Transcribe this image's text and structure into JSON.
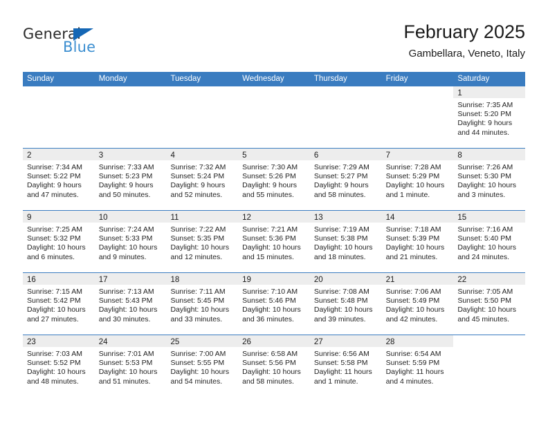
{
  "brand": {
    "name_part1": "General",
    "name_part2": "Blue",
    "triangle_color": "#1567b5",
    "blue_color": "#3b8ed0"
  },
  "header": {
    "title": "February 2025",
    "subtitle": "Gambellara, Veneto, Italy"
  },
  "theme": {
    "header_row_bg": "#3a7cc0",
    "row_divider": "#3a7cc0",
    "daynum_band_bg": "#ededed",
    "text": "#222222"
  },
  "calendar": {
    "weekday_headers": [
      "Sunday",
      "Monday",
      "Tuesday",
      "Wednesday",
      "Thursday",
      "Friday",
      "Saturday"
    ],
    "weeks": [
      [
        {
          "day": "",
          "empty": true,
          "lines": []
        },
        {
          "day": "",
          "empty": true,
          "lines": []
        },
        {
          "day": "",
          "empty": true,
          "lines": []
        },
        {
          "day": "",
          "empty": true,
          "lines": []
        },
        {
          "day": "",
          "empty": true,
          "lines": []
        },
        {
          "day": "",
          "empty": true,
          "lines": []
        },
        {
          "day": "1",
          "empty": false,
          "lines": [
            "Sunrise: 7:35 AM",
            "Sunset: 5:20 PM",
            "Daylight: 9 hours",
            "and 44 minutes."
          ]
        }
      ],
      [
        {
          "day": "2",
          "empty": false,
          "lines": [
            "Sunrise: 7:34 AM",
            "Sunset: 5:22 PM",
            "Daylight: 9 hours",
            "and 47 minutes."
          ]
        },
        {
          "day": "3",
          "empty": false,
          "lines": [
            "Sunrise: 7:33 AM",
            "Sunset: 5:23 PM",
            "Daylight: 9 hours",
            "and 50 minutes."
          ]
        },
        {
          "day": "4",
          "empty": false,
          "lines": [
            "Sunrise: 7:32 AM",
            "Sunset: 5:24 PM",
            "Daylight: 9 hours",
            "and 52 minutes."
          ]
        },
        {
          "day": "5",
          "empty": false,
          "lines": [
            "Sunrise: 7:30 AM",
            "Sunset: 5:26 PM",
            "Daylight: 9 hours",
            "and 55 minutes."
          ]
        },
        {
          "day": "6",
          "empty": false,
          "lines": [
            "Sunrise: 7:29 AM",
            "Sunset: 5:27 PM",
            "Daylight: 9 hours",
            "and 58 minutes."
          ]
        },
        {
          "day": "7",
          "empty": false,
          "lines": [
            "Sunrise: 7:28 AM",
            "Sunset: 5:29 PM",
            "Daylight: 10 hours",
            "and 1 minute."
          ]
        },
        {
          "day": "8",
          "empty": false,
          "lines": [
            "Sunrise: 7:26 AM",
            "Sunset: 5:30 PM",
            "Daylight: 10 hours",
            "and 3 minutes."
          ]
        }
      ],
      [
        {
          "day": "9",
          "empty": false,
          "lines": [
            "Sunrise: 7:25 AM",
            "Sunset: 5:32 PM",
            "Daylight: 10 hours",
            "and 6 minutes."
          ]
        },
        {
          "day": "10",
          "empty": false,
          "lines": [
            "Sunrise: 7:24 AM",
            "Sunset: 5:33 PM",
            "Daylight: 10 hours",
            "and 9 minutes."
          ]
        },
        {
          "day": "11",
          "empty": false,
          "lines": [
            "Sunrise: 7:22 AM",
            "Sunset: 5:35 PM",
            "Daylight: 10 hours",
            "and 12 minutes."
          ]
        },
        {
          "day": "12",
          "empty": false,
          "lines": [
            "Sunrise: 7:21 AM",
            "Sunset: 5:36 PM",
            "Daylight: 10 hours",
            "and 15 minutes."
          ]
        },
        {
          "day": "13",
          "empty": false,
          "lines": [
            "Sunrise: 7:19 AM",
            "Sunset: 5:38 PM",
            "Daylight: 10 hours",
            "and 18 minutes."
          ]
        },
        {
          "day": "14",
          "empty": false,
          "lines": [
            "Sunrise: 7:18 AM",
            "Sunset: 5:39 PM",
            "Daylight: 10 hours",
            "and 21 minutes."
          ]
        },
        {
          "day": "15",
          "empty": false,
          "lines": [
            "Sunrise: 7:16 AM",
            "Sunset: 5:40 PM",
            "Daylight: 10 hours",
            "and 24 minutes."
          ]
        }
      ],
      [
        {
          "day": "16",
          "empty": false,
          "lines": [
            "Sunrise: 7:15 AM",
            "Sunset: 5:42 PM",
            "Daylight: 10 hours",
            "and 27 minutes."
          ]
        },
        {
          "day": "17",
          "empty": false,
          "lines": [
            "Sunrise: 7:13 AM",
            "Sunset: 5:43 PM",
            "Daylight: 10 hours",
            "and 30 minutes."
          ]
        },
        {
          "day": "18",
          "empty": false,
          "lines": [
            "Sunrise: 7:11 AM",
            "Sunset: 5:45 PM",
            "Daylight: 10 hours",
            "and 33 minutes."
          ]
        },
        {
          "day": "19",
          "empty": false,
          "lines": [
            "Sunrise: 7:10 AM",
            "Sunset: 5:46 PM",
            "Daylight: 10 hours",
            "and 36 minutes."
          ]
        },
        {
          "day": "20",
          "empty": false,
          "lines": [
            "Sunrise: 7:08 AM",
            "Sunset: 5:48 PM",
            "Daylight: 10 hours",
            "and 39 minutes."
          ]
        },
        {
          "day": "21",
          "empty": false,
          "lines": [
            "Sunrise: 7:06 AM",
            "Sunset: 5:49 PM",
            "Daylight: 10 hours",
            "and 42 minutes."
          ]
        },
        {
          "day": "22",
          "empty": false,
          "lines": [
            "Sunrise: 7:05 AM",
            "Sunset: 5:50 PM",
            "Daylight: 10 hours",
            "and 45 minutes."
          ]
        }
      ],
      [
        {
          "day": "23",
          "empty": false,
          "lines": [
            "Sunrise: 7:03 AM",
            "Sunset: 5:52 PM",
            "Daylight: 10 hours",
            "and 48 minutes."
          ]
        },
        {
          "day": "24",
          "empty": false,
          "lines": [
            "Sunrise: 7:01 AM",
            "Sunset: 5:53 PM",
            "Daylight: 10 hours",
            "and 51 minutes."
          ]
        },
        {
          "day": "25",
          "empty": false,
          "lines": [
            "Sunrise: 7:00 AM",
            "Sunset: 5:55 PM",
            "Daylight: 10 hours",
            "and 54 minutes."
          ]
        },
        {
          "day": "26",
          "empty": false,
          "lines": [
            "Sunrise: 6:58 AM",
            "Sunset: 5:56 PM",
            "Daylight: 10 hours",
            "and 58 minutes."
          ]
        },
        {
          "day": "27",
          "empty": false,
          "lines": [
            "Sunrise: 6:56 AM",
            "Sunset: 5:58 PM",
            "Daylight: 11 hours",
            "and 1 minute."
          ]
        },
        {
          "day": "28",
          "empty": false,
          "lines": [
            "Sunrise: 6:54 AM",
            "Sunset: 5:59 PM",
            "Daylight: 11 hours",
            "and 4 minutes."
          ]
        },
        {
          "day": "",
          "empty": true,
          "lines": []
        }
      ]
    ]
  }
}
